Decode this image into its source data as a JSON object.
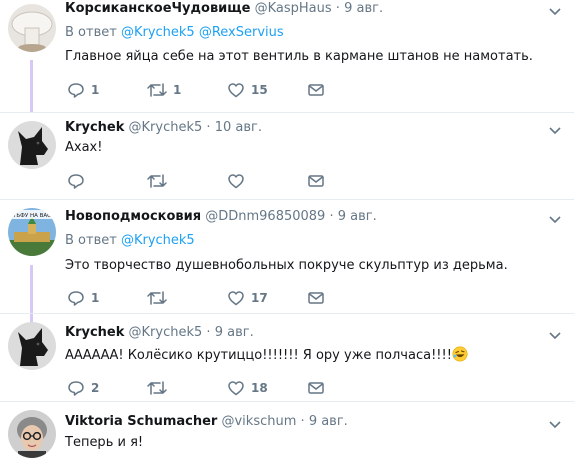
{
  "tweets": [
    {
      "name": "КорсиканскоеЧудовище",
      "handle": "@KaspHaus",
      "dot": "·",
      "time": "9 авг.",
      "reply_prefix": "В ответ",
      "reply_mentions": [
        "@Krychek5",
        "@RexServius"
      ],
      "text": "Главное яйца себе на этот вентиль в кармане штанов не намотать.",
      "replies": "1",
      "retweets": "1",
      "likes": "15",
      "avatar_icon": "mushroom-avatar"
    },
    {
      "name": "Krychek",
      "handle": "@Krychek5",
      "dot": "·",
      "time": "10 авг.",
      "text": "Ахах!",
      "replies": "",
      "retweets": "",
      "likes": "",
      "avatar_icon": "black-dog-avatar"
    },
    {
      "name": "Новоподмосковия",
      "handle": "@DDnm96850089",
      "dot": "·",
      "time": "9 авг.",
      "reply_prefix": "В ответ",
      "reply_mentions": [
        "@Krychek5"
      ],
      "text": "Это творчество душевнобольных покруче скульптур из дерьма.",
      "replies": "1",
      "retweets": "",
      "likes": "17",
      "avatar_icon": "kremlin-avatar",
      "avatar_text": "ТЬФУ НА ВАС"
    },
    {
      "name": "Krychek",
      "handle": "@Krychek5",
      "dot": "·",
      "time": "9 авг.",
      "text": "АААААА! Колёсико крутиццо!!!!!!! Я ору уже полчаса!!!!",
      "replies": "2",
      "retweets": "",
      "likes": "18",
      "avatar_icon": "black-dog-avatar",
      "emoji_icon": "rofl-emoji"
    },
    {
      "name": "Viktoria Schumacher",
      "handle": "@vikschum",
      "dot": "·",
      "time": "9 авг.",
      "text": "Теперь и я!",
      "avatar_icon": "woman-glasses-avatar"
    }
  ],
  "colors": {
    "accent": "#1da1f2",
    "muted": "#657786",
    "thread_line": "#d7c8f5",
    "divider": "#e6ecf0"
  }
}
